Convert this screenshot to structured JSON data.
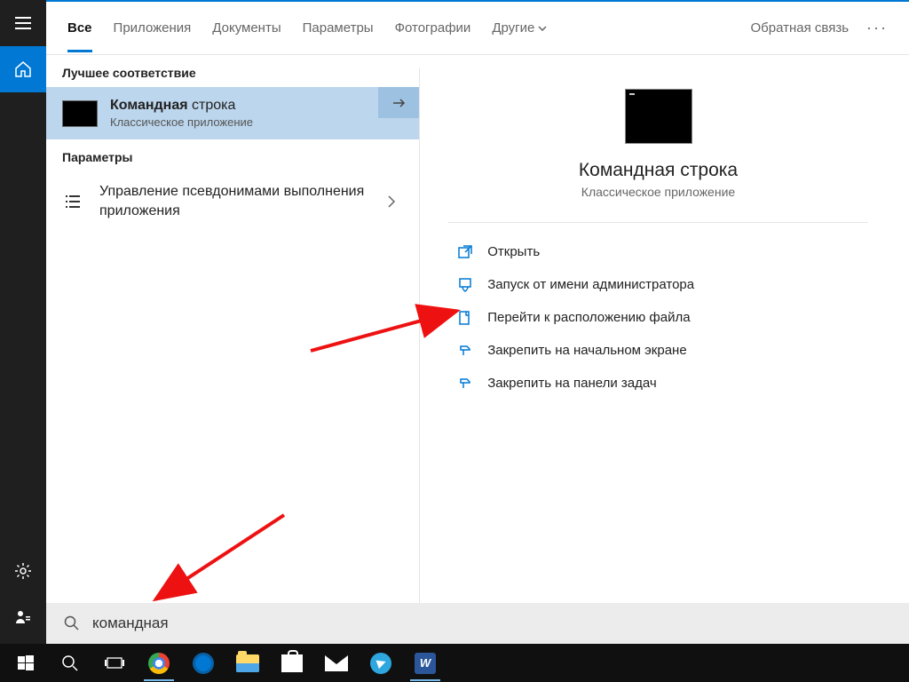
{
  "sidebar": {
    "items": [
      "menu",
      "home",
      "settings",
      "account"
    ]
  },
  "tabs": {
    "items": [
      "Все",
      "Приложения",
      "Документы",
      "Параметры",
      "Фотографии",
      "Другие"
    ],
    "feedback": "Обратная связь"
  },
  "left": {
    "best_match_header": "Лучшее соответствие",
    "result_title_bold": "Командная",
    "result_title_rest": " строка",
    "result_sub": "Классическое приложение",
    "settings_header": "Параметры",
    "settings_item": "Управление псевдонимами выполнения приложения"
  },
  "right": {
    "title": "Командная строка",
    "sub": "Классическое приложение",
    "actions": [
      "Открыть",
      "Запуск от имени администратора",
      "Перейти к расположению файла",
      "Закрепить на начальном экране",
      "Закрепить на панели задач"
    ]
  },
  "search": {
    "value": "командная"
  },
  "taskbar": {
    "word_label": "W"
  }
}
